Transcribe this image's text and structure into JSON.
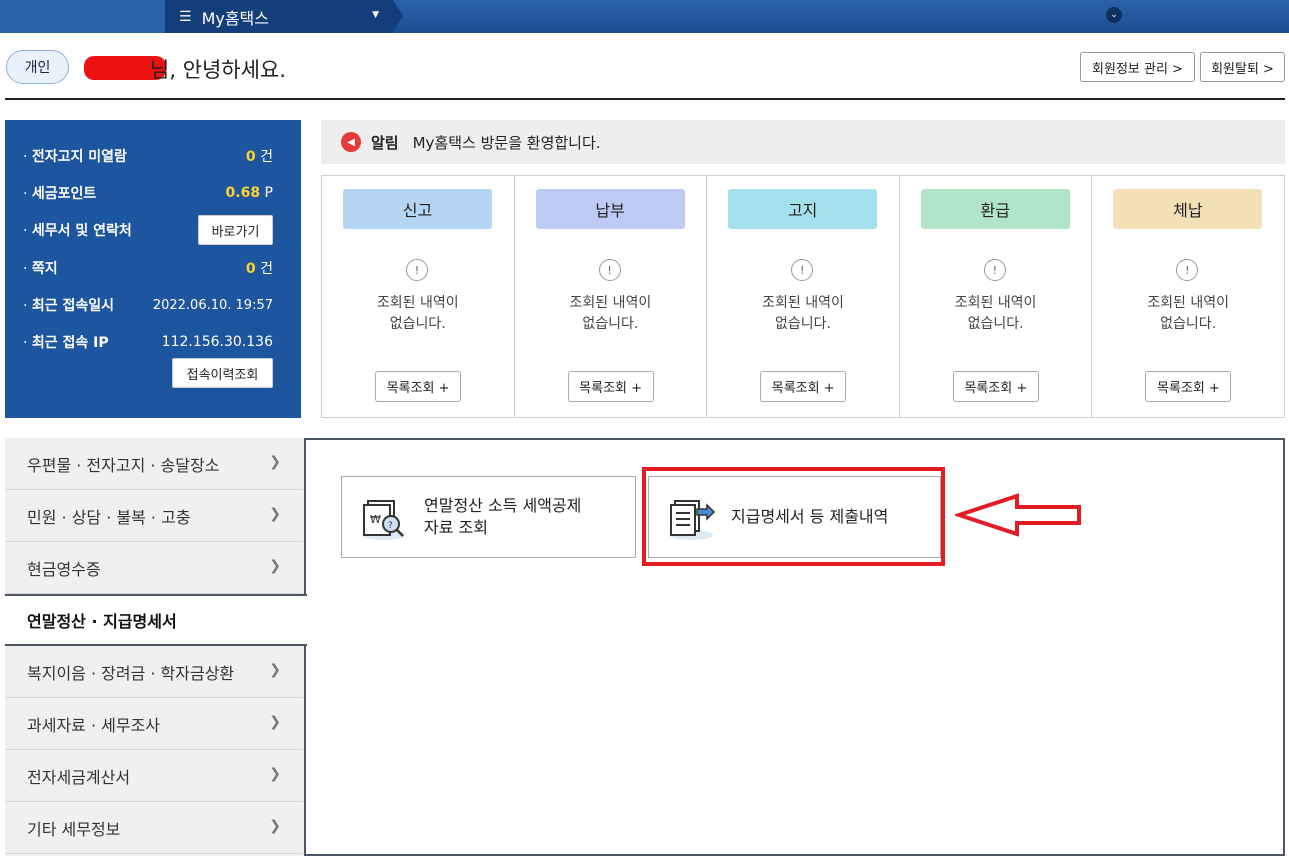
{
  "topbar": {
    "menu_label": "My홈택스",
    "menu_icon": "hamburger-icon",
    "dropdown_icon": "triangle-down-icon",
    "chevron_icon": "chevron-down-icon"
  },
  "greeting": {
    "type_label": "개인",
    "text": "님, 안녕하세요."
  },
  "header_buttons": {
    "member_info": "회원정보 관리 >",
    "withdraw": "회원탈퇴 >"
  },
  "info": {
    "unread_label": "전자고지 미열람",
    "unread_count": "0",
    "unread_unit": "건",
    "points_label": "세금포인트",
    "points_value": "0.68",
    "points_unit": "P",
    "office_label": "세무서 및 연락처",
    "office_button": "바로가기",
    "memo_label": "쪽지",
    "memo_count": "0",
    "memo_unit": "건",
    "last_login_label": "최근 접속일시",
    "last_login_value": "2022.06.10.  19:57",
    "last_ip_label": "최근 접속 IP",
    "last_ip_value": "112.156.30.136",
    "history_button": "접속이력조회"
  },
  "notice": {
    "label": "알림",
    "text": "My홈택스 방문을 환영합니다."
  },
  "categories": [
    {
      "title": "신고",
      "color": "#b5d6f3"
    },
    {
      "title": "납부",
      "color": "#bccaf4"
    },
    {
      "title": "고지",
      "color": "#a5e1ec"
    },
    {
      "title": "환급",
      "color": "#b2e5c7"
    },
    {
      "title": "체납",
      "color": "#f2e1b6"
    }
  ],
  "category_msg_line1": "조회된 내역이",
  "category_msg_line2": "없습니다.",
  "category_button": "목록조회 +",
  "warning_glyph": "!",
  "sidebar": {
    "items": [
      "우편물 · 전자고지 · 송달장소",
      "민원 · 상담 · 불복 · 고충",
      "현금영수증",
      "연말정산 · 지급명세서",
      "복지이음 · 장려금 · 학자금상환",
      "과세자료 · 세무조사",
      "전자세금계산서",
      "기타 세무정보"
    ],
    "active_index": 3
  },
  "cards": {
    "deduction_line1": "연말정산 소득 세액공제",
    "deduction_line2": "자료 조회",
    "statement": "지급명세서 등 제출내역"
  },
  "colors": {
    "accent": "#1d559e",
    "highlight": "#e21b24"
  }
}
